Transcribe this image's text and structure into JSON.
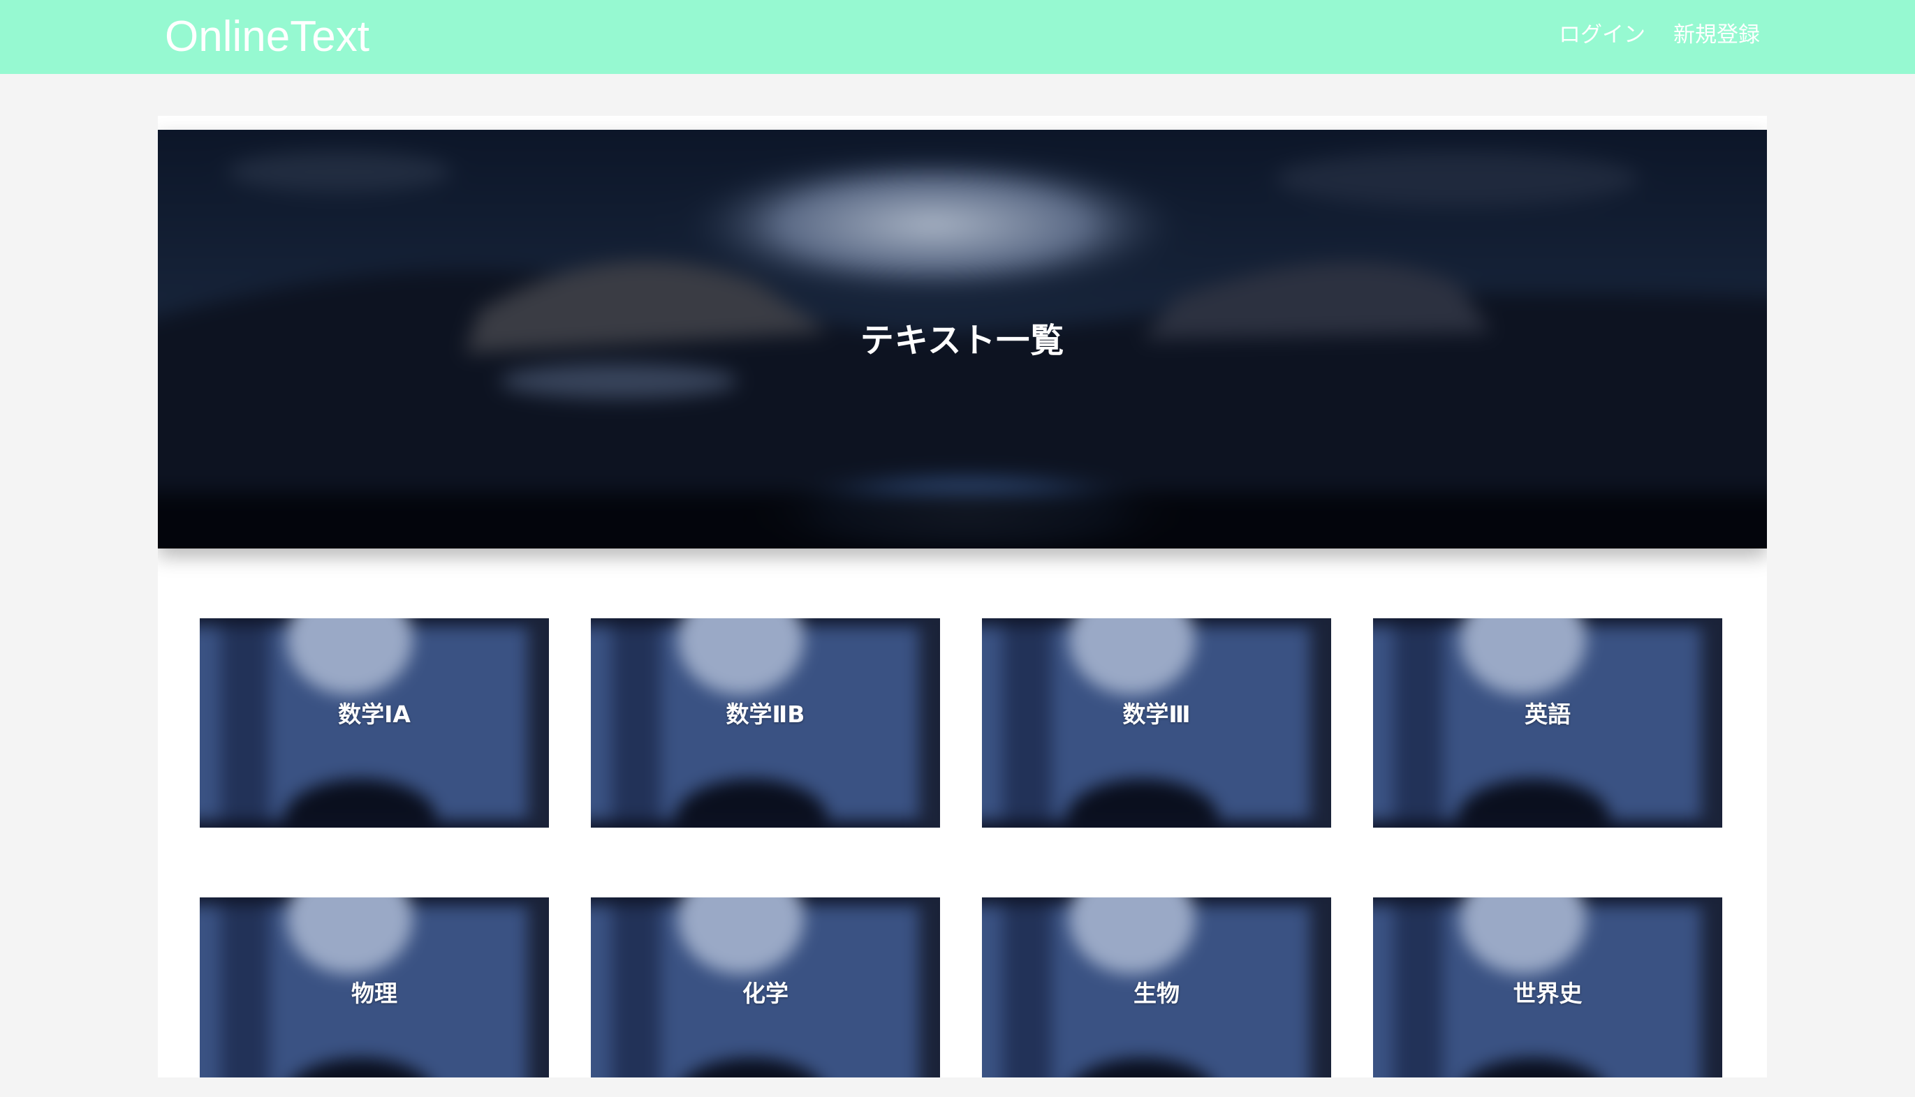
{
  "header": {
    "brand": "OnlineText",
    "nav": [
      {
        "label": "ログイン"
      },
      {
        "label": "新規登録"
      }
    ],
    "background_color": "#96f9d1"
  },
  "hero": {
    "title": "テキスト一覧"
  },
  "texts": [
    {
      "label": "数学ⅠA"
    },
    {
      "label": "数学ⅡB"
    },
    {
      "label": "数学Ⅲ"
    },
    {
      "label": "英語"
    },
    {
      "label": "物理"
    },
    {
      "label": "化学"
    },
    {
      "label": "生物"
    },
    {
      "label": "世界史"
    }
  ]
}
